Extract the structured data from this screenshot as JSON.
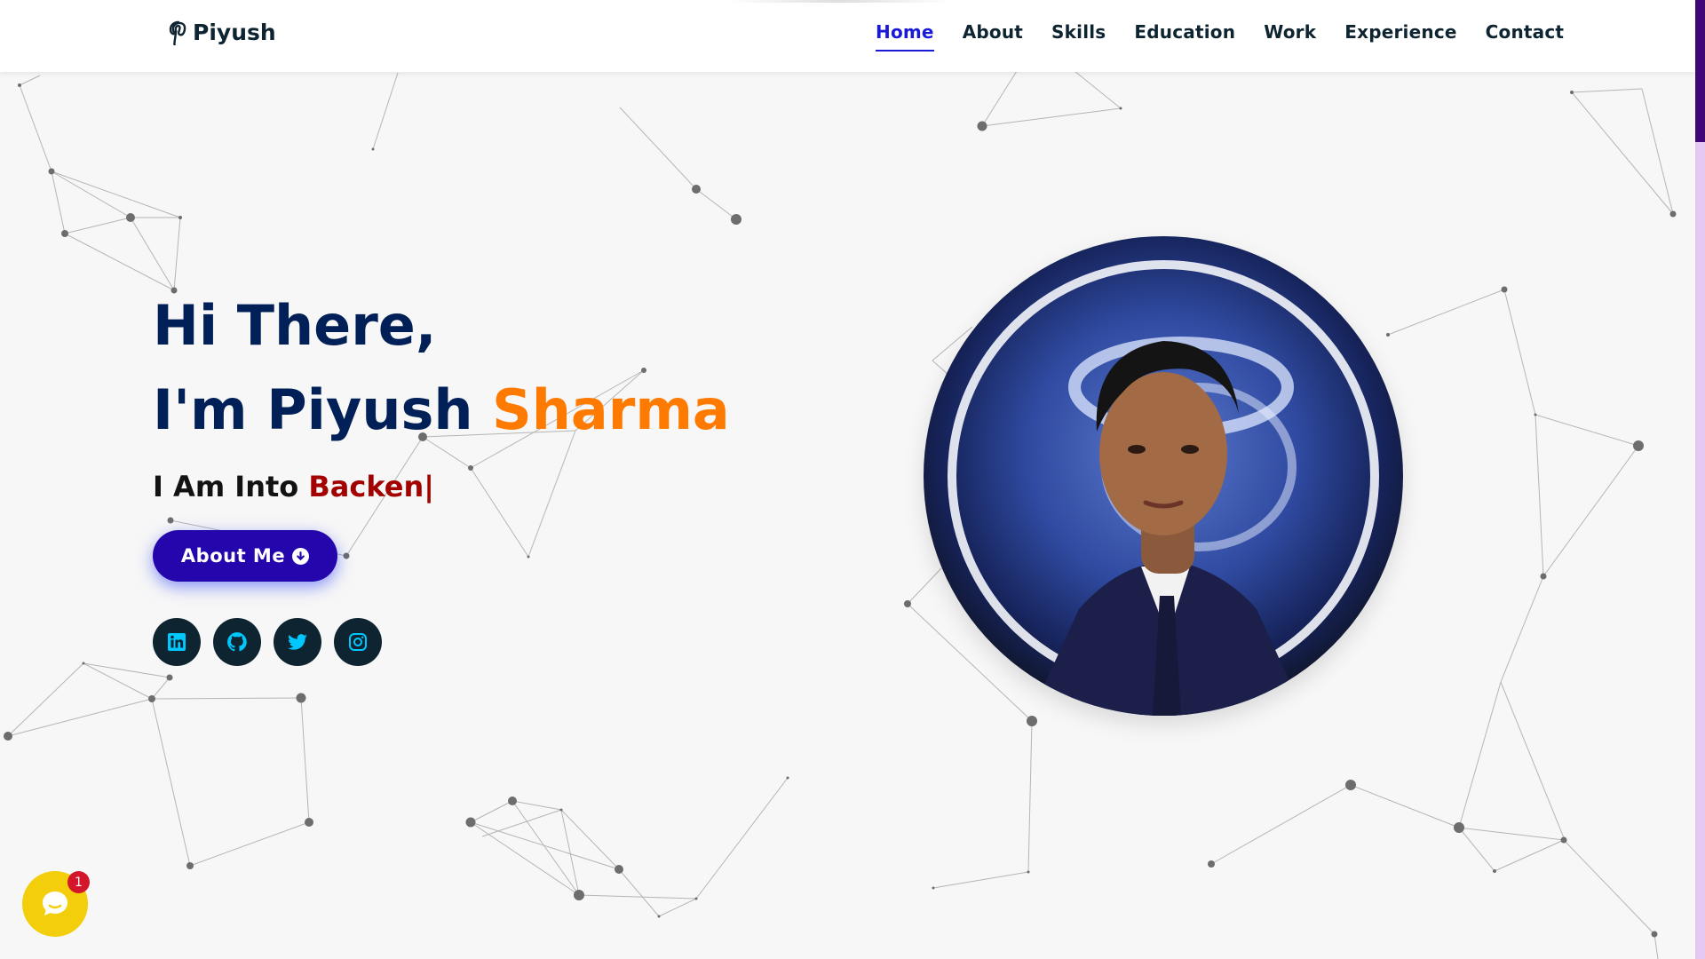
{
  "header": {
    "logo_text": "Piyush",
    "logo_icon": "pinterest-p-icon",
    "nav": [
      {
        "label": "Home",
        "active": true
      },
      {
        "label": "About"
      },
      {
        "label": "Skills"
      },
      {
        "label": "Education"
      },
      {
        "label": "Work"
      },
      {
        "label": "Experience"
      },
      {
        "label": "Contact"
      }
    ]
  },
  "hero": {
    "greeting": "Hi There,",
    "name_prefix": "I'm Piyush ",
    "name_accent": "Sharma",
    "typed_prefix": "I Am Into ",
    "typed_word": "Backen|",
    "button_label": "About Me",
    "button_icon": "arrow-circle-down-icon",
    "socials": [
      "linkedin-icon",
      "github-icon",
      "twitter-icon",
      "instagram-icon"
    ]
  },
  "chat": {
    "badge_count": "1",
    "icon": "chat-bubble-icon"
  },
  "colors": {
    "navy": "#002057",
    "accent_orange": "#ff7a00",
    "typed_red": "#a30000",
    "button": "#2506ad",
    "nav_active": "#1a1ad6",
    "social_bg": "#0e2431",
    "social_icon": "#00c8ff"
  }
}
